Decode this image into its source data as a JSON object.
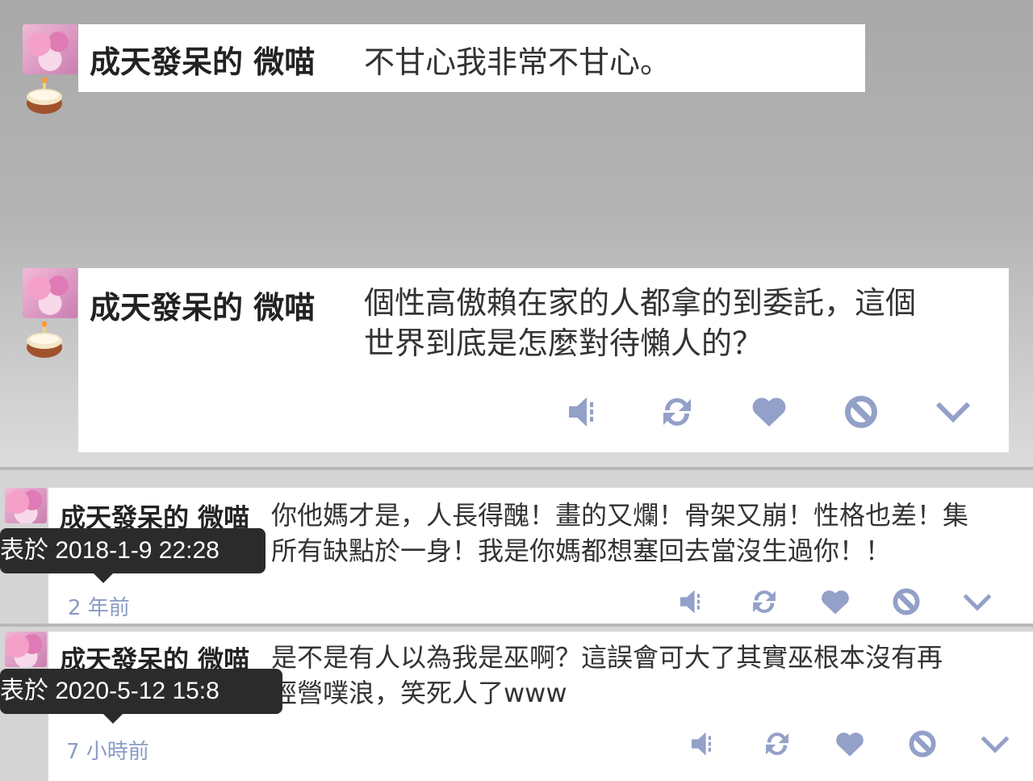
{
  "posts": [
    {
      "author": "成天發呆的 微喵",
      "text": "不甘心我非常不甘心。"
    },
    {
      "author": "成天發呆的 微喵",
      "text_line1": "個性高傲賴在家的人都拿的到委託，這個",
      "text_line2": "世界到底是怎麼對待懶人的？"
    },
    {
      "author": "成天發呆的 微喵",
      "text_line1": "你他媽才是，人長得醜！畫的又爛！骨架又崩！性格也差！集",
      "text_line2": "所有缺點於一身！我是你媽都想塞回去當沒生過你！！",
      "tooltip": "表於 2018-1-9 22:28",
      "time_ago": "2 年前"
    },
    {
      "author": "成天發呆的 微喵",
      "text_line1": "是不是有人以為我是巫啊？這誤會可大了其實巫根本沒有再",
      "text_line2": "經營噗浪，笑死人了www",
      "tooltip": "表於 2020-5-12 15:8",
      "time_ago": "7 小時前"
    }
  ],
  "action_icons": [
    "mute-icon",
    "replurk-icon",
    "heart-icon",
    "block-icon",
    "chevron-down-icon"
  ],
  "colors": {
    "action": "#93a0c8",
    "time": "#8a9bc4",
    "tooltip_bg": "#2b2b2b"
  }
}
